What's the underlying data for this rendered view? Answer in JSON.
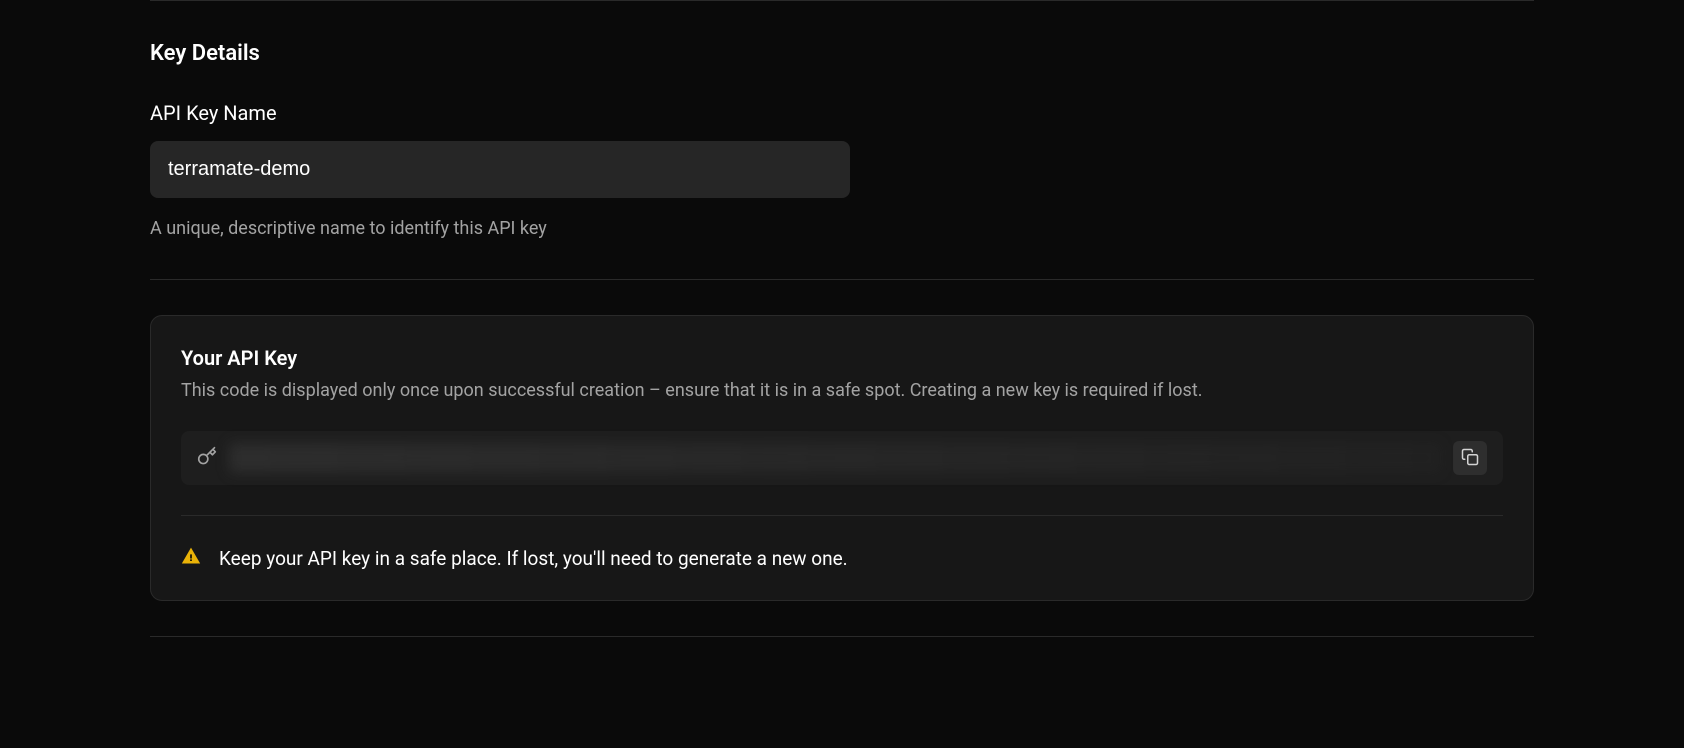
{
  "keyDetails": {
    "sectionTitle": "Key Details",
    "apiKeyName": {
      "label": "API Key Name",
      "value": "terramate-demo",
      "description": "A unique, descriptive name to identify this API key"
    }
  },
  "apiKeyCard": {
    "title": "Your API Key",
    "description": "This code is displayed only once upon successful creation – ensure that it is in a safe spot. Creating a new key is required if lost.",
    "warning": "Keep your API key in a safe place. If lost, you'll need to generate a new one."
  }
}
